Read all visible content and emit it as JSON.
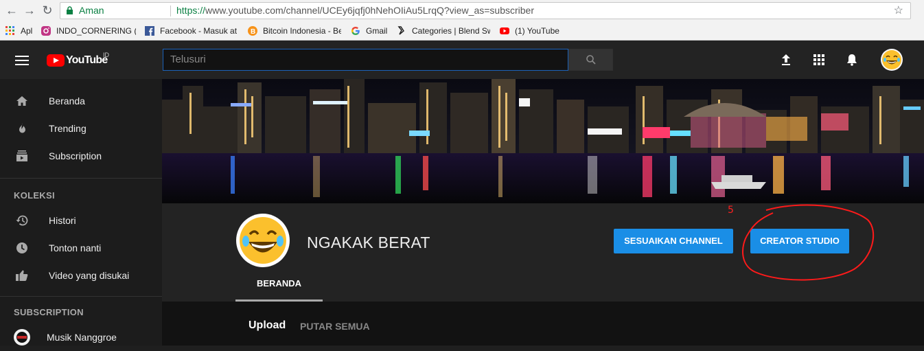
{
  "browser": {
    "secure_label": "Aman",
    "url_scheme": "https://",
    "url_rest": "www.youtube.com/channel/UCEy6jqfj0hNehOIiAu5LrqQ?view_as=subscriber",
    "bookmarks": [
      {
        "label": "Apl",
        "icon": "apps-grid-icon"
      },
      {
        "label": "INDO_CORNERING (@",
        "icon": "instagram-icon"
      },
      {
        "label": "Facebook - Masuk ata",
        "icon": "facebook-icon"
      },
      {
        "label": "Bitcoin Indonesia - Be",
        "icon": "bitcoin-icon"
      },
      {
        "label": "Gmail",
        "icon": "google-icon"
      },
      {
        "label": "Categories | Blend Sw",
        "icon": "blend-icon"
      },
      {
        "label": "(1) YouTube",
        "icon": "youtube-icon"
      }
    ]
  },
  "masthead": {
    "logo_text": "YouTube",
    "region": "ID",
    "search_placeholder": "Telusuri"
  },
  "sidebar": {
    "items": [
      {
        "label": "Beranda",
        "icon": "home-icon"
      },
      {
        "label": "Trending",
        "icon": "flame-icon"
      },
      {
        "label": "Subscription",
        "icon": "subscriptions-icon"
      }
    ],
    "koleksi_heading": "KOLEKSI",
    "koleksi": [
      {
        "label": "Histori",
        "icon": "history-icon"
      },
      {
        "label": "Tonton nanti",
        "icon": "clock-icon"
      },
      {
        "label": "Video yang disukai",
        "icon": "thumbs-up-icon"
      }
    ],
    "subscription_heading": "SUBSCRIPTION",
    "subscriptions": [
      {
        "label": "Musik Nanggroe"
      }
    ]
  },
  "channel": {
    "name": "NGAKAK BERAT",
    "customize_button": "SESUAIKAN CHANNEL",
    "studio_button": "CREATOR STUDIO",
    "tab_home": "BERANDA",
    "section_title": "Upload",
    "play_all": "PUTAR SEMUA",
    "annotation_mark": "5"
  },
  "colors": {
    "accent_blue": "#1a8ee6",
    "annotation_red": "#ff1a1a",
    "youtube_red": "#ff0000"
  }
}
